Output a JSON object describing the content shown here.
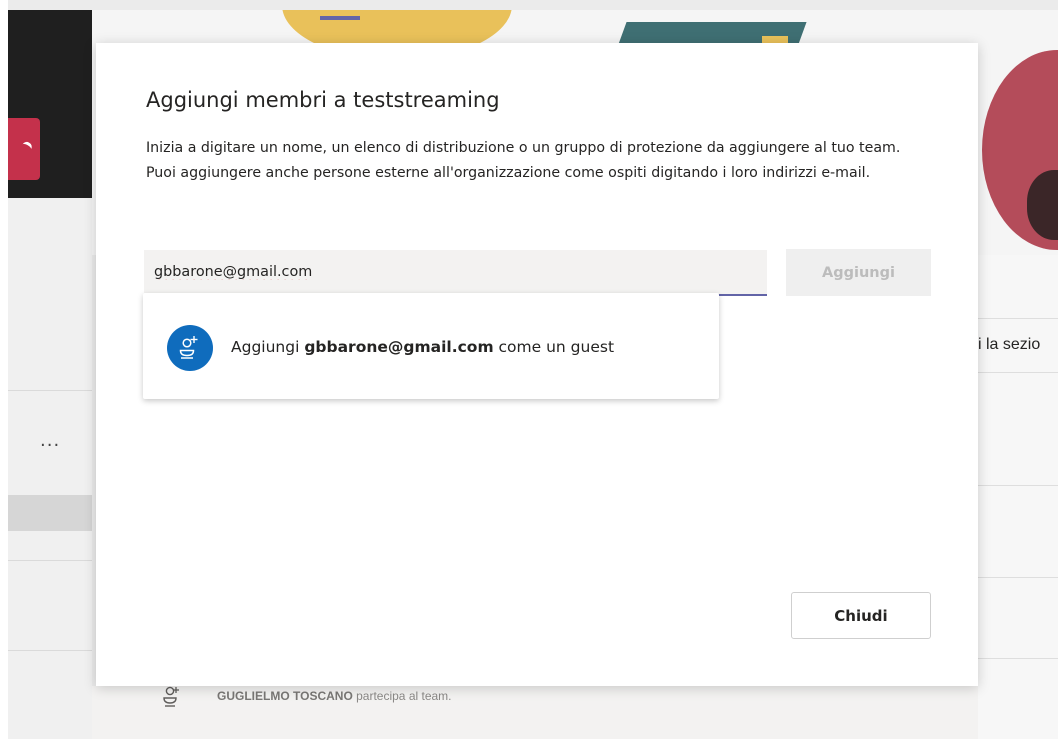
{
  "background": {
    "more_label": "...",
    "section_text": "i la sezio",
    "activity": {
      "name": "GUGLIELMO TOSCANO",
      "suffix": " partecipa al team."
    }
  },
  "dialog": {
    "title": "Aggiungi membri a teststreaming",
    "description": "Inizia a digitare un nome, un elenco di distribuzione o un gruppo di protezione da aggiungere al tuo team. Puoi aggiungere anche persone esterne all'organizzazione come ospiti digitando i loro indirizzi e-mail.",
    "input_value": "gbbarone@gmail.com",
    "add_label": "Aggiungi",
    "suggestion": {
      "prefix": "Aggiungi ",
      "email": "gbbarone@gmail.com",
      "suffix": " come un guest",
      "icon": "add-guest-icon"
    },
    "close_label": "Chiudi"
  },
  "colors": {
    "accent": "#6264a7",
    "guest_icon": "#0f6cbd",
    "red_tile": "#c4314b",
    "spellcheck": "#d13438"
  }
}
